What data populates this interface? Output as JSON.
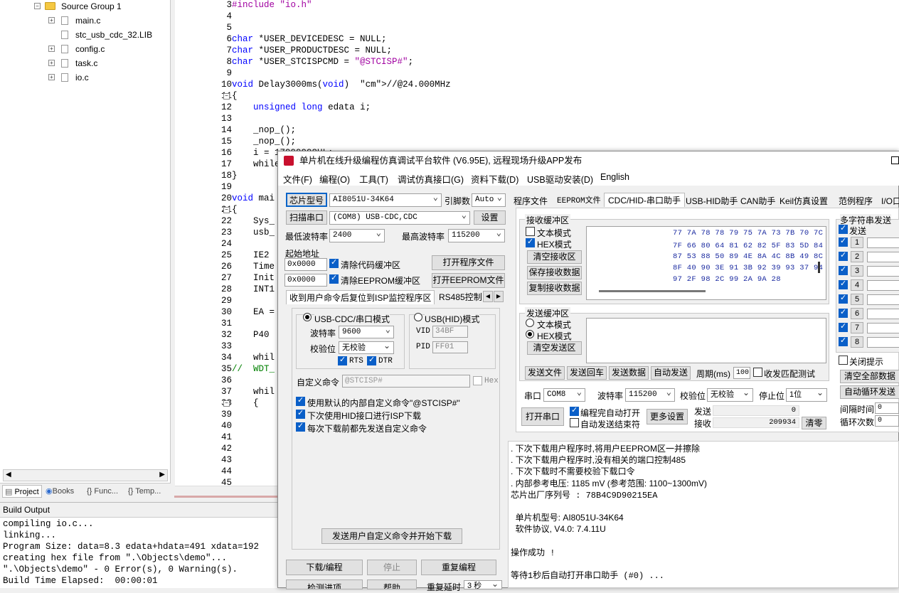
{
  "project_tree": {
    "group": "Source Group 1",
    "files": [
      "main.c",
      "stc_usb_cdc_32.LIB",
      "config.c",
      "task.c",
      "io.c"
    ],
    "tabs": [
      "Project",
      "Books",
      "Func...",
      "Temp..."
    ]
  },
  "editor": {
    "lines": [
      {
        "n": "3",
        "t": "#include \"io.h\""
      },
      {
        "n": "4",
        "t": ""
      },
      {
        "n": "5",
        "t": ""
      },
      {
        "n": "6",
        "t": "char *USER_DEVICEDESC = NULL;"
      },
      {
        "n": "7",
        "t": "char *USER_PRODUCTDESC = NULL;"
      },
      {
        "n": "8",
        "t": "char *USER_STCISPCMD = \"@STCISP#\";"
      },
      {
        "n": "9",
        "t": ""
      },
      {
        "n": "10",
        "t": "void Delay3000ms(void)  //@24.000MHz"
      },
      {
        "n": "11",
        "t": "{"
      },
      {
        "n": "12",
        "t": "    unsigned long edata i;"
      },
      {
        "n": "13",
        "t": ""
      },
      {
        "n": "14",
        "t": "    _nop_();"
      },
      {
        "n": "15",
        "t": "    _nop_();"
      },
      {
        "n": "16",
        "t": "    i = 17999998UL;"
      },
      {
        "n": "17",
        "t": "    while"
      },
      {
        "n": "18",
        "t": "}"
      },
      {
        "n": "19",
        "t": ""
      },
      {
        "n": "20",
        "t": "void mai"
      },
      {
        "n": "21",
        "t": "{"
      },
      {
        "n": "22",
        "t": "    Sys_"
      },
      {
        "n": "23",
        "t": "    usb_"
      },
      {
        "n": "24",
        "t": ""
      },
      {
        "n": "25",
        "t": "    IE2"
      },
      {
        "n": "26",
        "t": "    Time"
      },
      {
        "n": "27",
        "t": "    Init"
      },
      {
        "n": "28",
        "t": "    INT1"
      },
      {
        "n": "29",
        "t": ""
      },
      {
        "n": "30",
        "t": "    EA ="
      },
      {
        "n": "31",
        "t": ""
      },
      {
        "n": "32",
        "t": "    P40"
      },
      {
        "n": "33",
        "t": ""
      },
      {
        "n": "34",
        "t": "    whil"
      },
      {
        "n": "35",
        "t": "//  WDT_"
      },
      {
        "n": "36",
        "t": ""
      },
      {
        "n": "37",
        "t": "    whil"
      },
      {
        "n": "38",
        "t": "    {"
      },
      {
        "n": "39",
        "t": ""
      },
      {
        "n": "40",
        "t": ""
      },
      {
        "n": "41",
        "t": ""
      },
      {
        "n": "42",
        "t": ""
      },
      {
        "n": "43",
        "t": ""
      },
      {
        "n": "44",
        "t": ""
      },
      {
        "n": "45",
        "t": ""
      }
    ]
  },
  "build": {
    "header": "Build Output",
    "lines": [
      "compiling io.c...",
      "linking...",
      "Program Size: data=8.3 edata+hdata=491 xdata=192",
      "creating hex file from \".\\Objects\\demo\"...",
      "\".\\Objects\\demo\" - 0 Error(s), 0 Warning(s).",
      "Build Time Elapsed:  00:00:01"
    ]
  },
  "stc": {
    "title": "单片机在线升级编程仿真调试平台软件 (V6.95E), 远程现场升级APP发布",
    "menu": [
      "文件(F)",
      "编程(O)",
      "工具(T)",
      "调试仿真接口(G)",
      "资料下载(D)",
      "USB驱动安装(D)",
      "English"
    ],
    "left": {
      "chip_label": "芯片型号",
      "chip_value": "AI8051U-34K64",
      "pin_label": "引脚数",
      "pin_value": "Auto",
      "scan_label": "扫描串口",
      "port_value": "(COM8) USB-CDC,CDC",
      "settings_label": "设置",
      "min_baud_label": "最低波特率",
      "min_baud": "2400",
      "max_baud_label": "最高波特率",
      "max_baud": "115200",
      "start_addr_label": "起始地址",
      "addr1": "0x0000",
      "addr2": "0x0000",
      "clear_code": "清除代码缓冲区",
      "clear_eeprom": "清除EEPROM缓冲区",
      "open_prog": "打开程序文件",
      "open_eeprom": "打开EEPROM文件",
      "tab1": "收到用户命令后复位到ISP监控程序区",
      "tab2": "RS485控制",
      "cdc_mode": "USB-CDC/串口模式",
      "hid_mode": "USB(HID)模式",
      "baud_label": "波特率",
      "baud": "9600",
      "parity_label": "校验位",
      "parity": "无校验",
      "vid_label": "VID",
      "vid": "34BF",
      "pid_label": "PID",
      "pid": "FF01",
      "rts": "RTS",
      "dtr": "DTR",
      "custom_label": "自定义命令",
      "custom_value": "@STCISP#",
      "hex_label": "Hex",
      "opt1": "使用默认的内部自定义命令\"@STCISP#\"",
      "opt2": "下次使用HID接口进行ISP下载",
      "opt3": "每次下载前都先发送自定义命令",
      "send_custom": "发送用户自定义命令并开始下载",
      "download": "下载/编程",
      "stop": "停止",
      "reprogram": "重复编程",
      "check": "检测进项",
      "help": "帮助",
      "repeat_delay": "重复延时",
      "repeat_value": "3 秒"
    },
    "tabs": [
      "程序文件",
      "EEPROM文件",
      "CDC/HID-串口助手",
      "USB-HID助手",
      "CAN助手",
      "Keil仿真设置",
      "范例程序",
      "I/O口"
    ],
    "recv": {
      "title": "接收缓冲区",
      "text_mode": "文本模式",
      "hex_mode": "HEX模式",
      "clear": "清空接收区",
      "save": "保存接收数据",
      "copy": "复制接收数据",
      "hex_lines": [
        "77 7A 78 78 79 75 7A 73 7B 70 7C",
        "7F 66 80 64 81 62 82 5F 83 5D 84",
        "87 53 88 50 89 4E 8A 4C 8B 49 8C",
        "8F 40 90 3E 91 3B 92 39 93 37 94",
        "97 2F 98 2C 99 2A 9A 28"
      ]
    },
    "send": {
      "title": "发送缓冲区",
      "text_mode": "文本模式",
      "hex_mode": "HEX模式",
      "clear": "清空发送区",
      "send_file": "发送文件",
      "send_cr": "发送回车",
      "send_data": "发送数据",
      "auto_send": "自动发送",
      "period_label": "周期(ms)",
      "period": "100",
      "match_test": "收发匹配测试"
    },
    "port": {
      "port_label": "串口",
      "port": "COM8",
      "baud_label": "波特率",
      "baud": "115200",
      "parity_label": "校验位",
      "parity": "无校验",
      "stop_label": "停止位",
      "stop": "1位",
      "open": "打开串口",
      "auto_open": "编程完自动打开",
      "auto_end": "自动发送结束符",
      "more": "更多设置",
      "send_label": "发送",
      "send_count": "0",
      "recv_label": "接收",
      "recv_count": "209934",
      "zero": "清零"
    },
    "multi": {
      "title": "多字符串发送",
      "send": "发送",
      "rows": [
        "1",
        "2",
        "3",
        "4",
        "5",
        "6",
        "7",
        "8"
      ],
      "close_tip": "关闭提示",
      "clear_all": "清空全部数据",
      "auto_loop": "自动循环发送",
      "interval_label": "间隔时间",
      "interval": "0",
      "loop_label": "循环次数",
      "loop": "0"
    },
    "log": [
      ". 下次下载用户程序时,将用户EEPROM区一并擦除",
      ". 下次下载用户程序时,没有相关的端口控制485",
      ". 下次下载时不需要校验下载口令",
      ". 内部参考电压: 1185 mV (参考范围: 1100~1300mV)",
      "芯片出厂序列号 : 78B4C9D90215EA",
      "",
      "  单片机型号: AI8051U-34K64",
      "  软件协议, V4.0: 7.4.11U",
      "",
      "操作成功 !",
      "",
      "等待1秒后自动打开串口助手 (#0) ..."
    ]
  }
}
